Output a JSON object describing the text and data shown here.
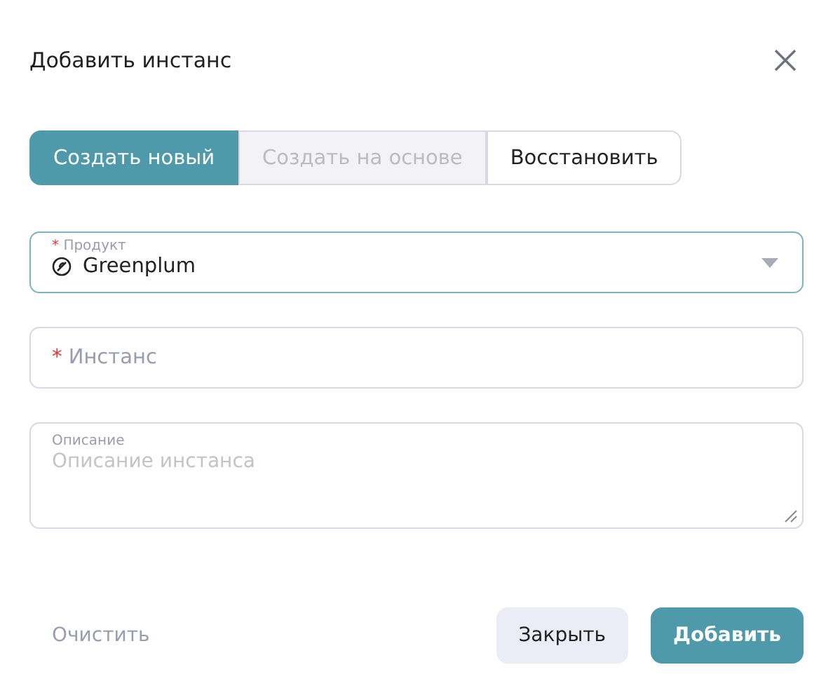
{
  "dialog": {
    "title": "Добавить инстанс"
  },
  "tabs": [
    {
      "label": "Создать новый",
      "selected": true,
      "disabled": false
    },
    {
      "label": "Создать на основе",
      "selected": false,
      "disabled": true
    },
    {
      "label": "Восстановить",
      "selected": false,
      "disabled": false
    }
  ],
  "product": {
    "label": "Продукт",
    "required": true,
    "required_mark": "*",
    "value": "Greenplum"
  },
  "instance": {
    "placeholder": "Инстанс",
    "required": true,
    "required_mark": "*"
  },
  "description": {
    "label": "Описание",
    "placeholder": "Описание инстанса"
  },
  "buttons": {
    "clear": "Очистить",
    "close": "Закрыть",
    "add": "Добавить"
  }
}
